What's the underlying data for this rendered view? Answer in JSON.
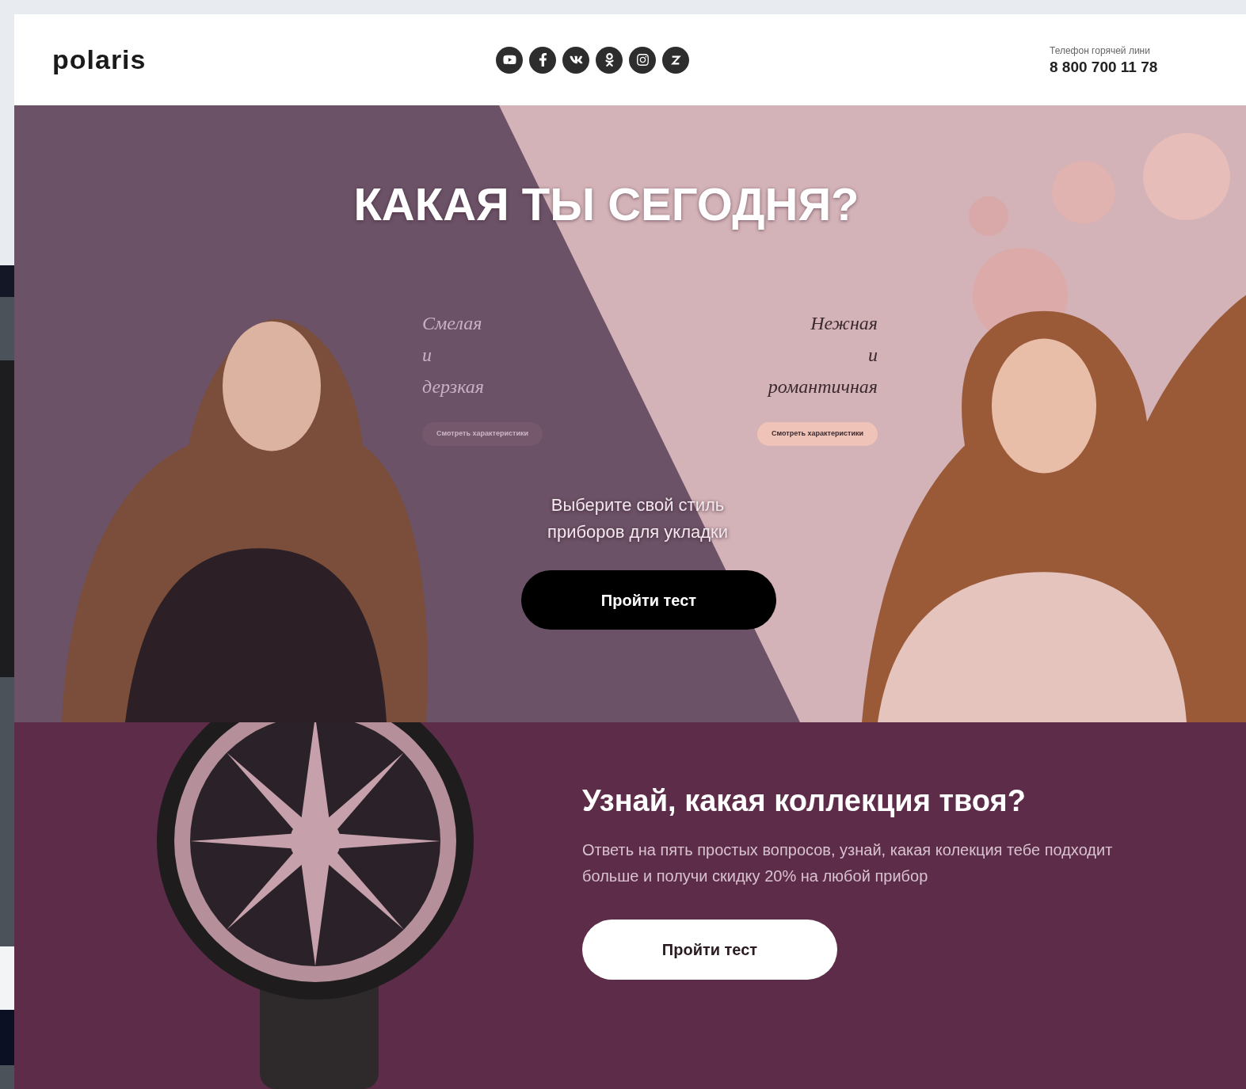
{
  "header": {
    "logo": "polaris",
    "hotline_label": "Телефон горячей лини",
    "hotline_phone": "8 800 700 11 78"
  },
  "hero": {
    "title": "КАКАЯ ТЫ СЕГОДНЯ?",
    "styles": [
      {
        "kind": "dark",
        "script": [
          "Смелая",
          "и",
          "дерзкая"
        ],
        "button": "Смотреть характеристики"
      },
      {
        "kind": "light",
        "script": [
          "Нежная",
          "и",
          "романтичная"
        ],
        "button": "Смотреть характеристики"
      }
    ],
    "subtitle": "Выберите свой стиль приборов для укладки",
    "button": "Пройти тест"
  },
  "quiz": {
    "title": "Узнай, какая коллекция твоя?",
    "text": "Ответь на пять простых вопросов, узнай, какая колекция тебе подходит больше и получи скидку 20% на любой прибор",
    "button": "Пройти тест"
  }
}
